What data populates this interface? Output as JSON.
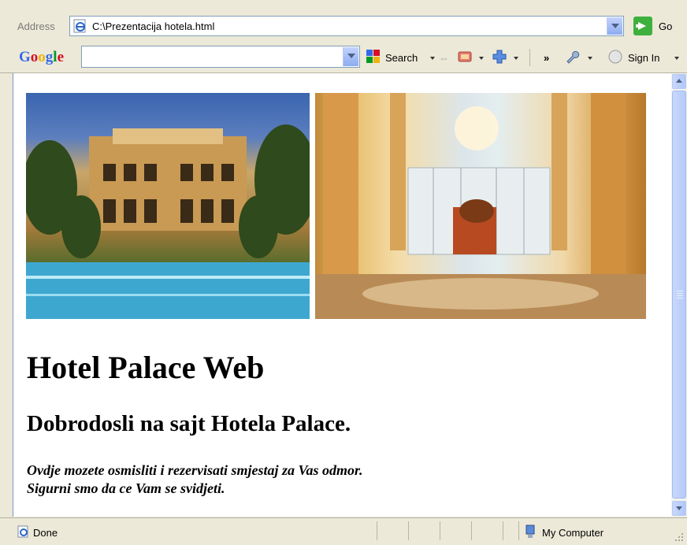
{
  "address_bar": {
    "label": "Address",
    "url": "C:\\Prezentacija hotela.html",
    "go_label": "Go"
  },
  "google_toolbar": {
    "logo": "Google",
    "search_label": "Search",
    "sign_in_label": "Sign In",
    "more_label": "»"
  },
  "page": {
    "heading": "Hotel Palace Web",
    "subheading": "Dobrodosli na sajt Hotela Palace.",
    "paragraph_line1": "Ovdje mozete osmisliti i rezervisati smjestaj za Vas odmor.",
    "paragraph_line2": "Sigurni smo da ce Vam se svidjeti."
  },
  "status_bar": {
    "status": "Done",
    "zone": "My Computer"
  },
  "colors": {
    "google_blue": "#3369e8",
    "google_red": "#d50f25",
    "google_yellow": "#eeb211",
    "google_green": "#009925"
  }
}
